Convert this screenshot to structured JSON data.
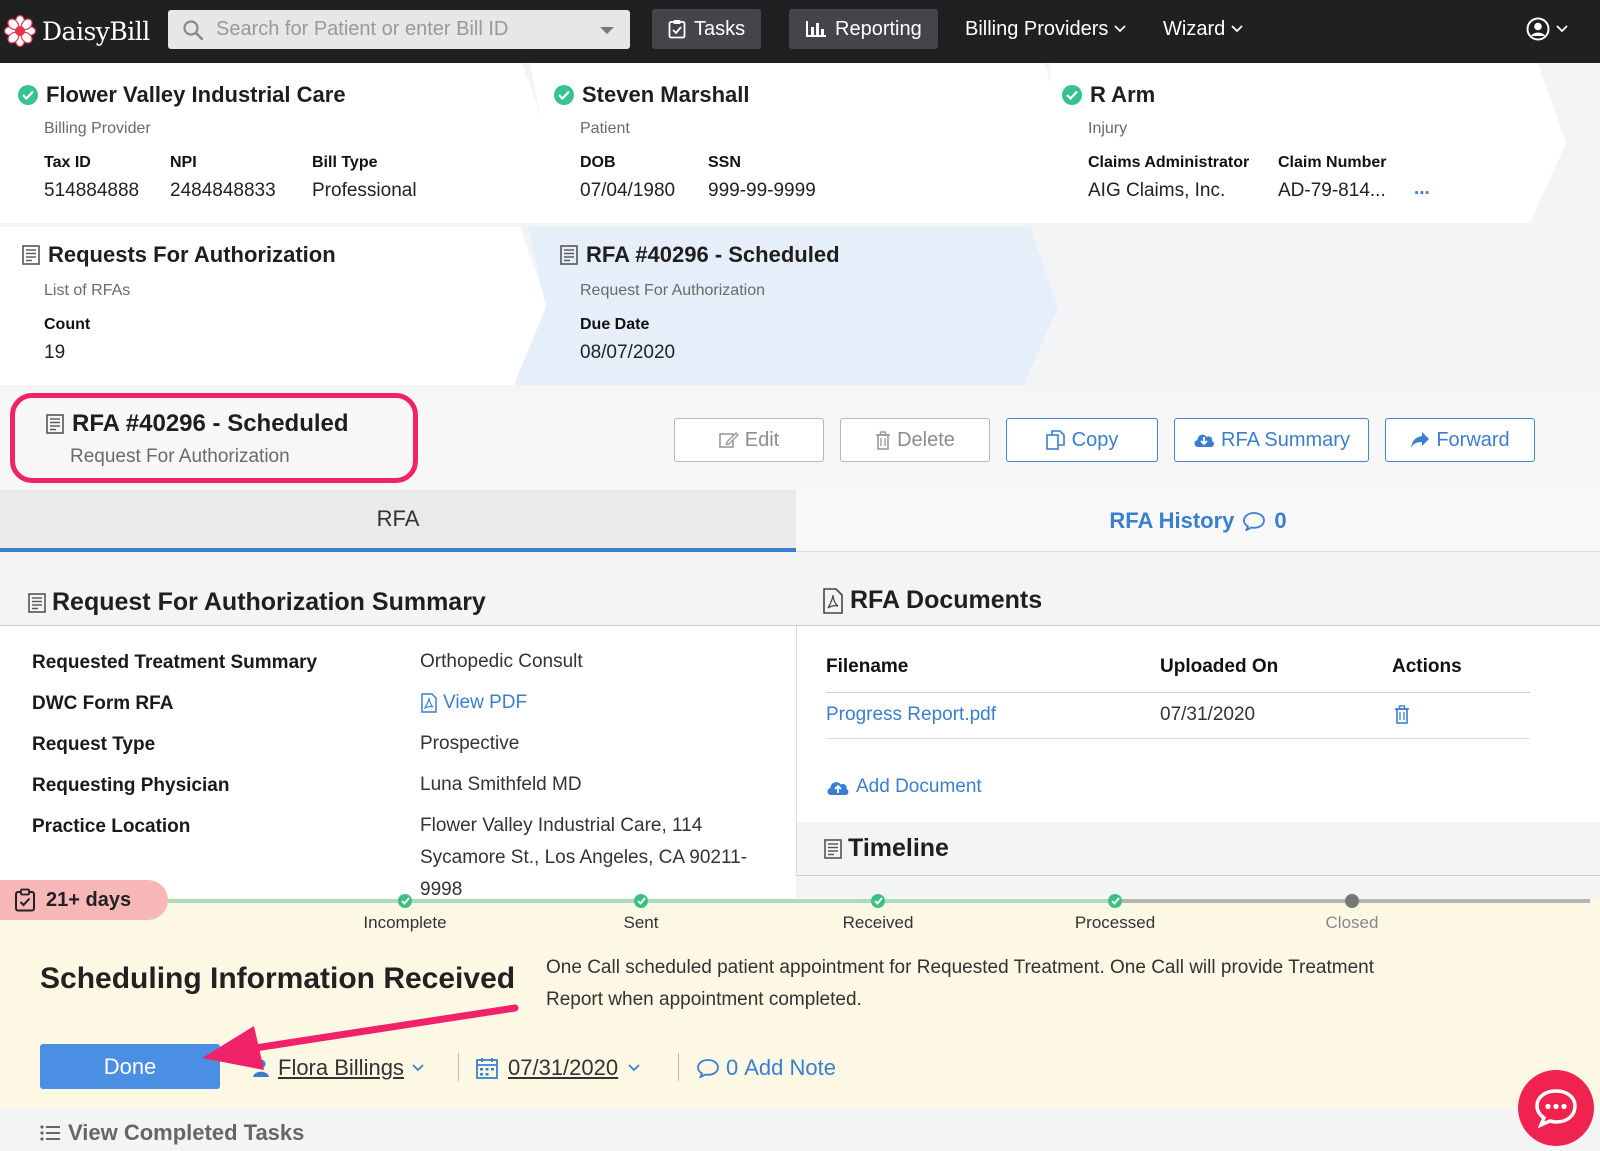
{
  "nav": {
    "brand": "DaisyBill",
    "search_placeholder": "Search for Patient or enter Bill ID",
    "tasks": "Tasks",
    "reporting": "Reporting",
    "billing_providers": "Billing Providers",
    "wizard": "Wizard"
  },
  "cards": {
    "provider": {
      "title": "Flower Valley Industrial Care",
      "subtitle": "Billing Provider",
      "fields": [
        {
          "label": "Tax ID",
          "value": "514884888"
        },
        {
          "label": "NPI",
          "value": "2484848833"
        },
        {
          "label": "Bill Type",
          "value": "Professional"
        }
      ]
    },
    "patient": {
      "title": "Steven Marshall",
      "subtitle": "Patient",
      "fields": [
        {
          "label": "DOB",
          "value": "07/04/1980"
        },
        {
          "label": "SSN",
          "value": "999-99-9999"
        }
      ]
    },
    "injury": {
      "title": "R Arm",
      "subtitle": "Injury",
      "fields": [
        {
          "label": "Claims Administrator",
          "value": "AIG Claims, Inc."
        },
        {
          "label": "Claim Number",
          "value": "AD-79-814..."
        }
      ],
      "more": "..."
    },
    "rfas": {
      "title": "Requests For Authorization",
      "subtitle": "List of RFAs",
      "count_label": "Count",
      "count_value": "19"
    },
    "rfa": {
      "title": "RFA #40296 - Scheduled",
      "subtitle": "Request For Authorization",
      "due_label": "Due Date",
      "due_value": "08/07/2020"
    }
  },
  "header": {
    "title": "RFA #40296 - Scheduled",
    "subtitle": "Request For Authorization"
  },
  "actions": {
    "edit": "Edit",
    "delete": "Delete",
    "copy": "Copy",
    "summary": "RFA Summary",
    "forward": "Forward"
  },
  "tabs": {
    "rfa": "RFA",
    "history": "RFA History",
    "history_count": "0"
  },
  "summary": {
    "title": "Request For Authorization Summary",
    "rows": [
      {
        "label": "Requested Treatment Summary",
        "value": "Orthopedic Consult"
      },
      {
        "label": "DWC Form RFA",
        "value": "View PDF"
      },
      {
        "label": "Request Type",
        "value": "Prospective"
      },
      {
        "label": "Requesting Physician",
        "value": "Luna Smithfeld MD"
      },
      {
        "label": "Practice Location",
        "value": "Flower Valley Industrial Care, 114 Sycamore St., Los Angeles, CA 90211-9998"
      }
    ]
  },
  "documents": {
    "title": "RFA Documents",
    "columns": [
      "Filename",
      "Uploaded On",
      "Actions"
    ],
    "rows": [
      {
        "filename": "Progress Report.pdf",
        "uploaded_on": "07/31/2020"
      }
    ],
    "add_label": "Add Document"
  },
  "timeline": {
    "title": "Timeline"
  },
  "task": {
    "age_badge": "21+ days",
    "steps": [
      "Incomplete",
      "Sent",
      "Received",
      "Processed",
      "Closed"
    ],
    "title": "Scheduling Information Received",
    "description": "One Call scheduled patient appointment for Requested Treatment. One Call will provide Treatment Report when appointment completed.",
    "done_label": "Done",
    "assignee": "Flora Billings",
    "date": "07/31/2020",
    "note_count": "0",
    "note_label": "Add Note"
  },
  "footer": {
    "completed_link": "View Completed Tasks"
  },
  "colors": {
    "accent": "#3a7fcf",
    "success": "#38c28e",
    "highlight": "#f0226a",
    "task_panel": "#fcf8e4"
  }
}
